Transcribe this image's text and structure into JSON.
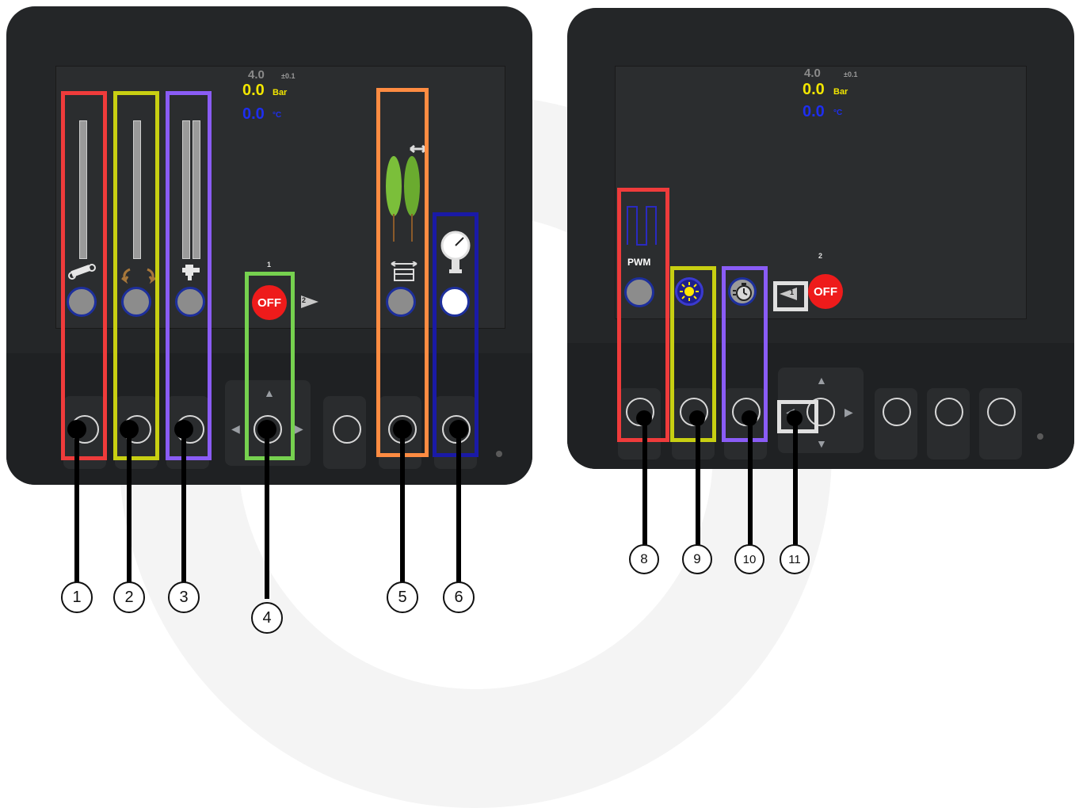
{
  "left_display": {
    "readout": {
      "setpoint": "4.0",
      "tolerance": "±0.1",
      "pressure_value": "0.0",
      "pressure_unit": "Bar",
      "temp_value": "0.0",
      "temp_unit": "°C"
    },
    "page_number": "1",
    "off_label": "OFF",
    "next_page_badge": "2",
    "icons": [
      "boom-cylinder-icon",
      "boom-fold-arrows-icon",
      "nozzle-tap-icon",
      "tree-width-icon",
      "pressure-gauge-icon"
    ]
  },
  "right_display": {
    "readout": {
      "setpoint": "4.0",
      "tolerance": "±0.1",
      "pressure_value": "0.0",
      "pressure_unit": "Bar",
      "temp_value": "0.0",
      "temp_unit": "°C"
    },
    "page_number": "2",
    "off_label": "OFF",
    "prev_page_badge": "1",
    "pwm_label": "PWM",
    "icons": [
      "pwm-signal-icon",
      "light-icon",
      "timer-icon"
    ]
  },
  "callouts": {
    "left": [
      "1",
      "2",
      "3",
      "4",
      "5",
      "6"
    ],
    "right": [
      "8",
      "9",
      "10",
      "11"
    ]
  },
  "colors": {
    "red": "#ef3b3b",
    "yellow_green": "#c8cf12",
    "purple": "#8a5cf6",
    "green": "#76d14f",
    "orange": "#ff8c42",
    "navy": "#1a1aa6",
    "light_grey": "#e0e0e0",
    "readout_yellow": "#f2e600",
    "readout_blue": "#1e2ef0"
  }
}
